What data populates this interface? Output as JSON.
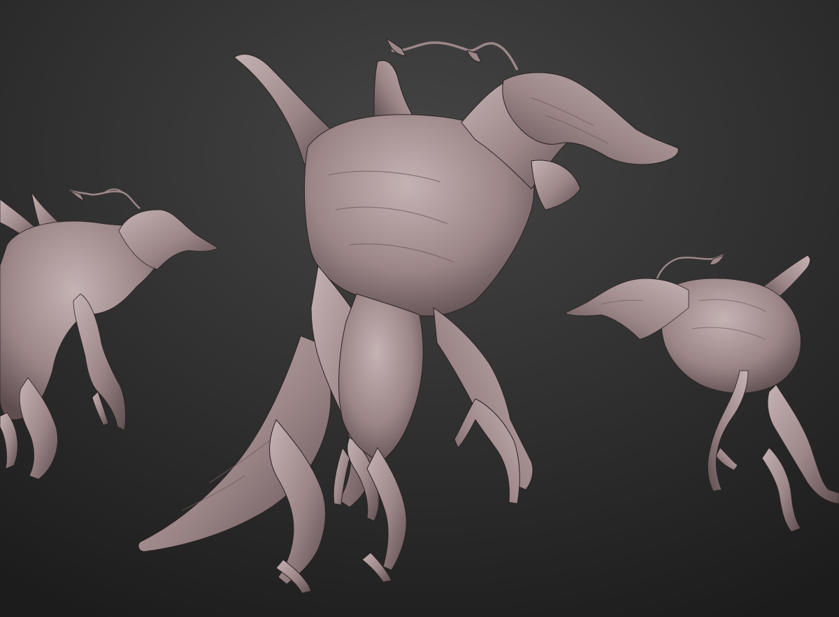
{
  "scene": {
    "background": {
      "top_color": "#454545",
      "bottom_color": "#1c1c1c"
    },
    "material": {
      "base_color": "#9c8688",
      "light_color": "#c5b2b3",
      "shadow_color": "#5f4e50",
      "outline_color": "#2a2222"
    },
    "sculpts": [
      {
        "name": "creature-sculpt-side-view"
      },
      {
        "name": "creature-sculpt-front-view"
      },
      {
        "name": "creature-sculpt-reverse-side-view"
      }
    ]
  }
}
